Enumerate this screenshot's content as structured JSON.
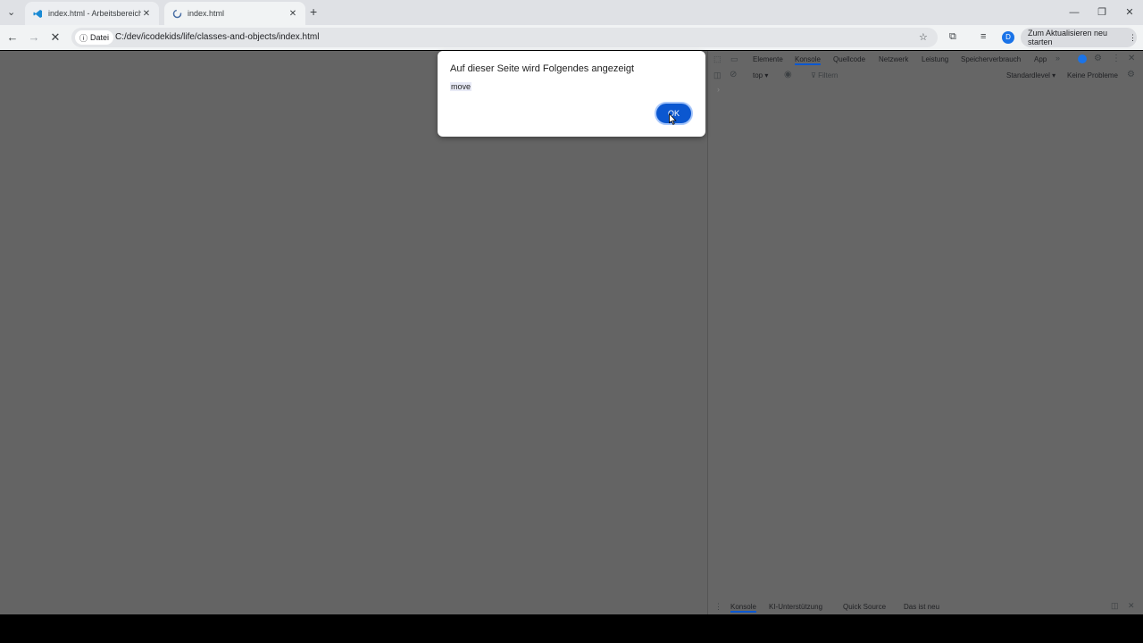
{
  "browser": {
    "tabs": [
      {
        "title": "index.html - Arbeitsbereich - Vi",
        "icon": "vscode-icon",
        "close": "✕"
      },
      {
        "title": "index.html",
        "icon": "loading-icon",
        "close": "✕"
      }
    ],
    "new_tab": "+",
    "address": {
      "chip": "Datei",
      "url": "C:/dev/icodekids/life/classes-and-objects/index.html"
    },
    "profile_initial": "D",
    "update_button": "Zum Aktualisieren neu starten"
  },
  "devtools": {
    "tabs": [
      "Elemente",
      "Konsole",
      "Quellcode",
      "Netzwerk",
      "Leistung",
      "Speicherverbrauch",
      "App"
    ],
    "active_tab": "Konsole",
    "context": "top",
    "filter_placeholder": "Filtern",
    "level": "Standardlevel",
    "issues": "Keine Probleme",
    "prompt": "›",
    "drawer_tabs": [
      "Konsole",
      "KI-Unterstützung",
      "Quick Source",
      "Das ist neu"
    ]
  },
  "dialog": {
    "title": "Auf dieser Seite wird Folgendes angezeigt",
    "message": "move",
    "ok": "OK"
  },
  "colors": {
    "accent": "#0b57d0",
    "page_overlay": "#646464"
  }
}
